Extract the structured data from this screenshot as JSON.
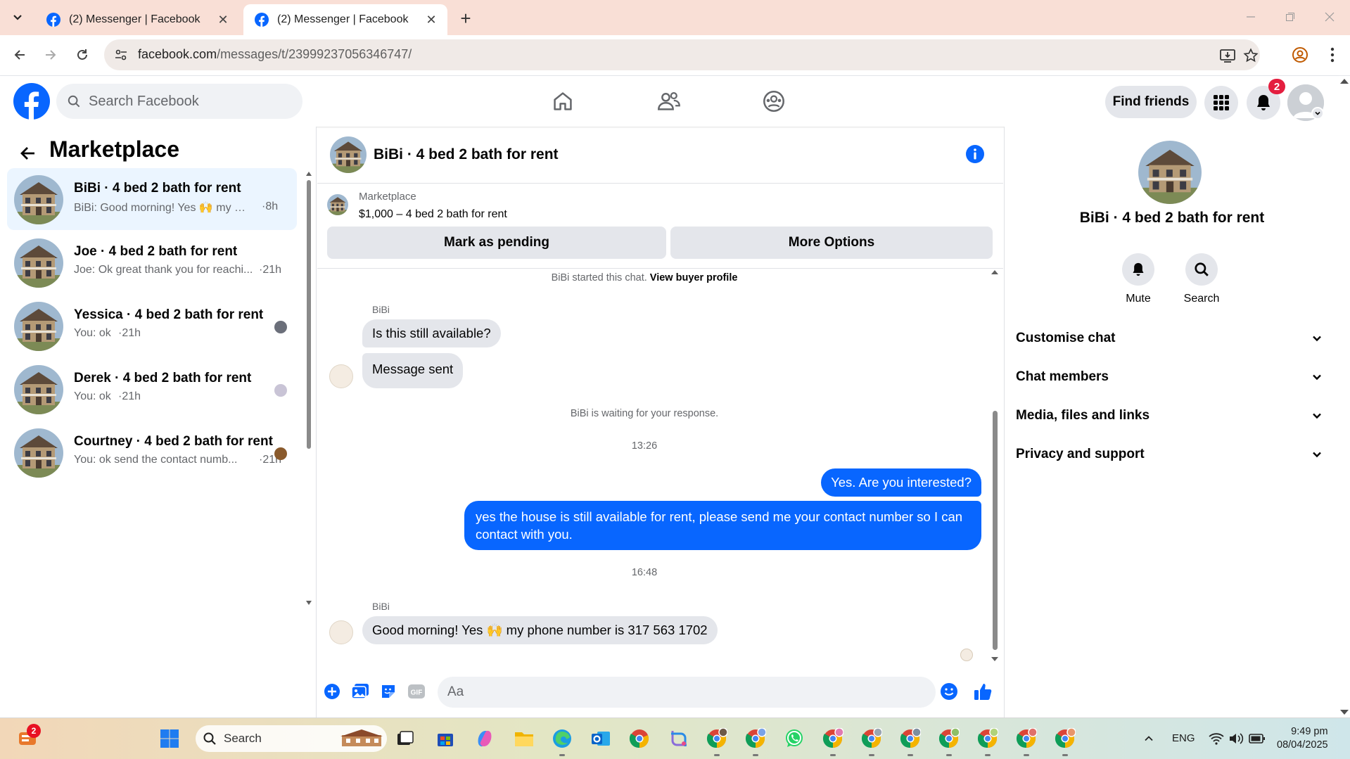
{
  "browser": {
    "tabs": [
      {
        "title": "(2) Messenger | Facebook",
        "active": false
      },
      {
        "title": "(2) Messenger | Facebook",
        "active": true
      }
    ],
    "url_domain": "facebook.com",
    "url_path": "/messages/t/23999237056346747/"
  },
  "header": {
    "search_placeholder": "Search Facebook",
    "find_friends_label": "Find friends",
    "notification_count": "2"
  },
  "left_panel": {
    "title": "Marketplace",
    "conversations": [
      {
        "name": "BiBi · 4 bed 2 bath for rent",
        "preview": "BiBi: Good morning! Yes 🙌 my ph...",
        "time": "·8h",
        "active": true
      },
      {
        "name": "Joe · 4 bed 2 bath for rent",
        "preview": "Joe: Ok great thank you for reachi...",
        "time": "·21h",
        "active": false
      },
      {
        "name": "Yessica · 4 bed 2 bath for rent",
        "preview": "You: ok",
        "time": "·21h",
        "active": false
      },
      {
        "name": "Derek · 4 bed 2 bath for rent",
        "preview": "You: ok",
        "time": "·21h",
        "active": false
      },
      {
        "name": "Courtney · 4 bed 2 bath for rent",
        "preview": "You: ok send the contact numb...",
        "time": "·21h",
        "active": false
      }
    ]
  },
  "chat": {
    "title": "BiBi · 4 bed 2 bath for rent",
    "marketplace_label": "Marketplace",
    "listing": "$1,000 – 4 bed 2 bath for rent",
    "mark_pending_label": "Mark as pending",
    "more_options_label": "More Options",
    "started_text": "BiBi started this chat.",
    "view_profile_label": "View buyer profile",
    "sender_name_1": "BiBi",
    "msg_in_1": "Is this still available?",
    "msg_in_2": "Message sent",
    "waiting_text": "BiBi is waiting for your response.",
    "time_1": "13:26",
    "msg_out_1": "Yes. Are you interested?",
    "msg_out_2": "yes the house is still available for rent, please send me your contact number so I can contact with you.",
    "time_2": "16:48",
    "sender_name_2": "BiBi",
    "msg_in_3": "Good morning! Yes 🙌 my phone number is 317 563 1702",
    "input_placeholder": "Aa"
  },
  "right_panel": {
    "name": "BiBi · 4 bed 2 bath for rent",
    "actions": [
      {
        "label": "Mute",
        "icon": "bell-icon"
      },
      {
        "label": "Search",
        "icon": "search-icon"
      }
    ],
    "sections": [
      "Customise chat",
      "Chat members",
      "Media, files and links",
      "Privacy and support"
    ]
  },
  "taskbar": {
    "search_label": "Search",
    "widget_badge": "2",
    "language": "ENG",
    "time": "9:49 pm",
    "date": "08/04/2025"
  },
  "colors": {
    "fb_blue": "#0866ff",
    "tab_strip": "#f9dfd6",
    "active_conv": "#ebf5ff",
    "badge_red": "#e41e3f"
  }
}
